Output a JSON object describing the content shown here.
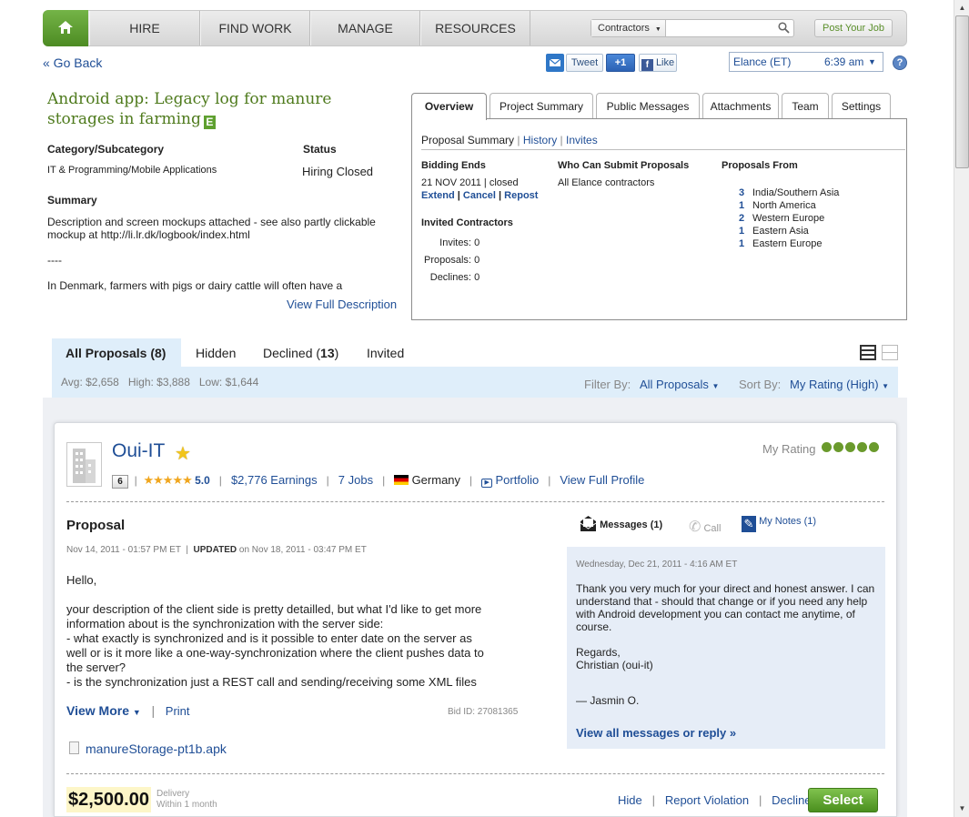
{
  "nav": {
    "items": [
      "HIRE",
      "FIND WORK",
      "MANAGE",
      "RESOURCES"
    ],
    "search_scope": "Contractors",
    "post_job": "Post Your Job"
  },
  "top": {
    "go_back": "« Go Back",
    "tweet": "Tweet",
    "plus_one": "+1",
    "like": "Like",
    "timezone": "Elance (ET)",
    "time": "6:39 am",
    "help": "?"
  },
  "project": {
    "title": "Android app: Legacy log for manure storages in farming",
    "badge": "E",
    "category_label": "Category/Subcategory",
    "category_value": "IT & Programming/Mobile Applications",
    "status_label": "Status",
    "status_value": "Hiring Closed",
    "summary_label": "Summary",
    "summary_p1": "Description and screen mockups attached - see also partly clickable mockup at http://li.lr.dk/logbook/index.html",
    "summary_p2": "----",
    "summary_p3": "In Denmark, farmers with pigs or dairy cattle will often have a",
    "view_full": "View Full Description"
  },
  "panel": {
    "tabs": [
      "Overview",
      "Project Summary",
      "Public Messages",
      "Attachments",
      "Team",
      "Settings"
    ],
    "sub_links": {
      "summary": "Proposal Summary",
      "history": "History",
      "invites": "Invites"
    },
    "bidding_ends_label": "Bidding Ends",
    "bidding_ends_date": "21 NOV 2011",
    "bidding_ends_state": "closed",
    "actions": {
      "extend": "Extend",
      "cancel": "Cancel",
      "repost": "Repost"
    },
    "who_label": "Who Can Submit Proposals",
    "who_value": "All Elance contractors",
    "from_label": "Proposals From",
    "from": [
      {
        "count": "3",
        "region": "India/Southern Asia"
      },
      {
        "count": "1",
        "region": "North America"
      },
      {
        "count": "2",
        "region": "Western Europe"
      },
      {
        "count": "1",
        "region": "Eastern Asia"
      },
      {
        "count": "1",
        "region": "Eastern Europe"
      }
    ],
    "invited_label": "Invited Contractors",
    "invited": [
      {
        "label": "Invites:",
        "value": "0"
      },
      {
        "label": "Proposals:",
        "value": "0"
      },
      {
        "label": "Declines:",
        "value": "0"
      }
    ]
  },
  "proposals": {
    "tab_all": "All Proposals",
    "tab_all_count": "(8)",
    "tab_hidden": "Hidden",
    "tab_declined": "Declined",
    "tab_declined_count": "13",
    "tab_invited": "Invited",
    "stats": "Avg: $2,658   High: $3,888   Low: $1,644",
    "filter_label": "Filter By:",
    "filter_value": "All Proposals",
    "sort_label": "Sort By:",
    "sort_value": "My Rating (High)"
  },
  "bid": {
    "name": "Oui-IT",
    "level": "6",
    "rating": "5.0",
    "earnings": "$2,776 Earnings",
    "jobs": "7 Jobs",
    "country": "Germany",
    "portfolio": "Portfolio",
    "full_profile": "View Full Profile",
    "my_rating_label": "My Rating",
    "my_rating_value": 5,
    "proposal_heading": "Proposal",
    "date": "Nov 14, 2011 - 01:57 PM ET",
    "updated_label": "UPDATED",
    "updated_date": "on Nov 18, 2011 - 03:47 PM ET",
    "body_hello": "Hello,",
    "body_lines": [
      "your description of the client side is pretty detailled, but what I'd like to get more",
      "information about is the synchronization with the server side:",
      "- what exactly is synchronized and is it possible to enter date on the server as",
      "well or is it more like a one-way-synchronization where the client pushes data to",
      "the server?",
      "- is the synchronization just a REST call and sending/receiving some XML files"
    ],
    "view_more": "View More",
    "print": "Print",
    "bid_id": "Bid ID: 27081365",
    "attachment": "manureStorage-pt1b.apk",
    "price": "$2,500.00",
    "delivery_label": "Delivery",
    "delivery_value": "Within 1 month",
    "actions": {
      "hide": "Hide",
      "report": "Report Violation",
      "decline": "Decline",
      "select": "Select"
    }
  },
  "messages": {
    "tab_messages": "Messages (1)",
    "tab_call": "Call",
    "tab_notes": "My Notes (1)",
    "date": "Wednesday, Dec 21, 2011 - 4:16 AM ET",
    "text": "Thank you very much for your direct and honest answer. I can understand that - should that change or if you need any help with Android development you can contact me anytime, of course.",
    "regards": "Regards,",
    "signature": "Christian (oui-it)",
    "author": "— Jasmin O.",
    "view_all": "View all messages or reply »"
  },
  "colors": {
    "brand_green": "#5fa030",
    "link_blue": "#1f4e96",
    "title_green": "#4e7a1c",
    "bar_blue": "#dfeefa"
  }
}
